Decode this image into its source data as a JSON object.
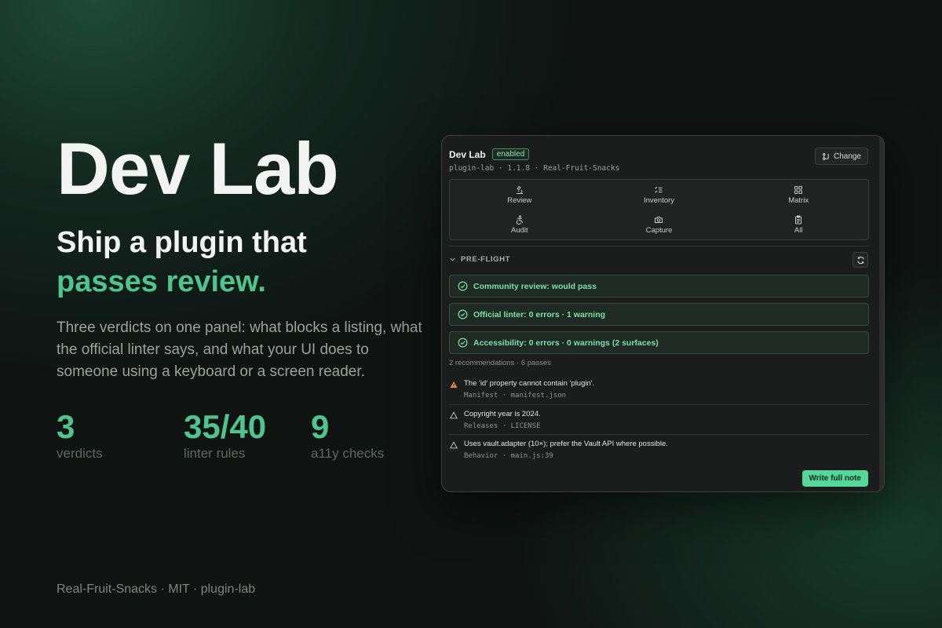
{
  "hero": {
    "title": "Dev Lab",
    "tagline_line1": "Ship a plugin that",
    "tagline_line2": "passes review.",
    "description": "Three verdicts on one panel: what blocks a listing, what the official linter says, and what your UI does to someone using a keyboard or a screen reader."
  },
  "stats": [
    {
      "value": "3",
      "label": "verdicts"
    },
    {
      "value": "35/40",
      "label": "linter rules"
    },
    {
      "value": "9",
      "label": "a11y checks"
    }
  ],
  "footer": "Real-Fruit-Snacks · MIT · plugin-lab",
  "panel": {
    "title": "Dev Lab",
    "status_badge": "enabled",
    "meta": "plugin-lab · 1.1.8 · Real-Fruit-Snacks",
    "change_label": "Change",
    "nav": [
      {
        "label": "Review",
        "icon": "microscope-icon"
      },
      {
        "label": "Inventory",
        "icon": "checklist-icon"
      },
      {
        "label": "Matrix",
        "icon": "grid-icon"
      },
      {
        "label": "Audit",
        "icon": "accessibility-icon"
      },
      {
        "label": "Capture",
        "icon": "camera-icon"
      },
      {
        "label": "All",
        "icon": "clipboard-icon"
      }
    ],
    "section_label": "PRE-FLIGHT",
    "verdicts": [
      "Community review: would pass",
      "Official linter: 0 errors · 1 warning",
      "Accessibility: 0 errors · 0 warnings (2 surfaces)"
    ],
    "recommendations_summary": "2 recommendations · 6 passes",
    "recommendations": [
      {
        "message": "The 'id' property cannot contain 'plugin'.",
        "location": "Manifest · manifest.json",
        "severity": "warning"
      },
      {
        "message": "Copyright year is 2024.",
        "location": "Releases · LICENSE",
        "severity": "info"
      },
      {
        "message": "Uses vault.adapter (10×); prefer the Vault API where possible.",
        "location": "Behavior · main.js:39",
        "severity": "info"
      }
    ],
    "write_button": "Write full note"
  },
  "colors": {
    "accent": "#4fc58d",
    "button": "#56d79a",
    "warning": "#e5893b"
  }
}
